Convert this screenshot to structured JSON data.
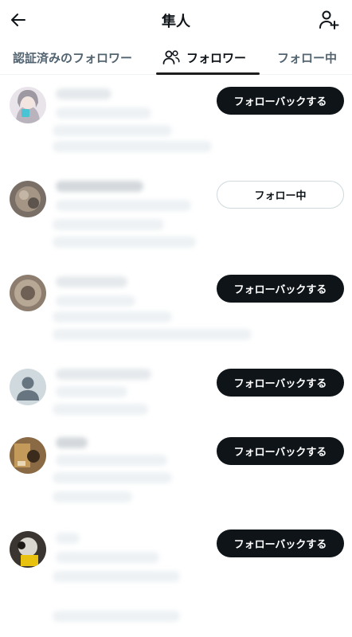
{
  "header": {
    "title": "隼人",
    "back_icon": "arrow-left-icon",
    "add_icon": "person-add-icon"
  },
  "tabs": [
    {
      "label": "認証済みのフォロワー",
      "active": false
    },
    {
      "label": "フォロワー",
      "active": true,
      "icon": "people-icon"
    },
    {
      "label": "フォロー中",
      "active": false
    }
  ],
  "users": [
    {
      "button_label": "フォローバックする",
      "button_state": "follow-back",
      "avatar": "anime-girl-avatar"
    },
    {
      "button_label": "フォロー中",
      "button_state": "following",
      "avatar": "photo-avatar"
    },
    {
      "button_label": "フォローバックする",
      "button_state": "follow-back",
      "avatar": "photo-avatar"
    },
    {
      "button_label": "フォローバックする",
      "button_state": "follow-back",
      "avatar": "default-avatar"
    },
    {
      "button_label": "フォローバックする",
      "button_state": "follow-back",
      "avatar": "photo-avatar"
    },
    {
      "button_label": "フォローバックする",
      "button_state": "follow-back",
      "avatar": "photo-avatar"
    }
  ],
  "colors": {
    "primary_text": "#0f1419",
    "secondary_text": "#536471",
    "button_dark": "#0f1419",
    "border": "#cfd9de",
    "divider": "#eff3f4"
  }
}
